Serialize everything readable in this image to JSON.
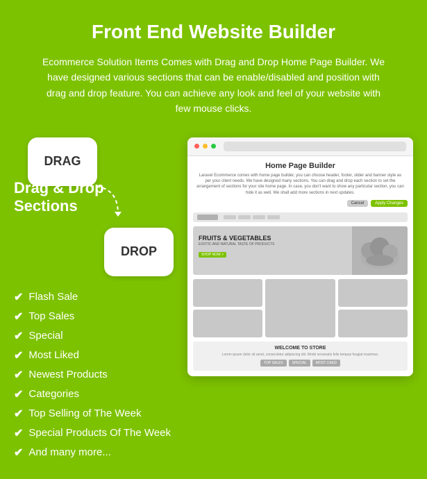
{
  "header": {
    "title": "Front End Website Builder",
    "description": "Ecommerce Solution Items Comes with Drag and Drop Home Page Builder. We have designed various sections that can be enable/disabled and position with drag and drop feature. You can achieve any look and feel of your website with few mouse clicks."
  },
  "drag_drop": {
    "drag_label": "DRAG",
    "drop_label": "DROP",
    "section_label": "Drag & Drop\nSections"
  },
  "checklist": {
    "items": [
      "Flash Sale",
      "Top Sales",
      "Special",
      "Most Liked",
      "Newest Products",
      "Categories",
      "Top Selling of The Week",
      "Special Products Of The Week",
      "And many more..."
    ]
  },
  "mockup": {
    "title": "Home Page Builder",
    "description": "Laravel Ecommerce comes with home page builder, you can choose header, footer, slider and banner style as per your client needs. We have designed many sections. You can drag and drop each section to set the arrangement of sections for your site home page. In case, you don't want to show any particular section, you can hide it as well. We shall add more sections in next updates.",
    "cancel_label": "Cancel",
    "apply_label": "Apply Changes",
    "banner_title": "FRUITS & VEGETABLES",
    "banner_subtitle": "EXOTIC AND NATURAL TASTE OF PRODUCTS",
    "banner_btn": "SHOP NOW >",
    "welcome_title": "WELCOME TO STORE",
    "welcome_text": "Lorem ipsum dolor sit amet, consectetur adipiscing elit. Morbi venenatis felis tempus feugiat maximus.",
    "welcome_btns": [
      "TOP SALES",
      "SPECIAL",
      "MOST LIKED"
    ]
  }
}
